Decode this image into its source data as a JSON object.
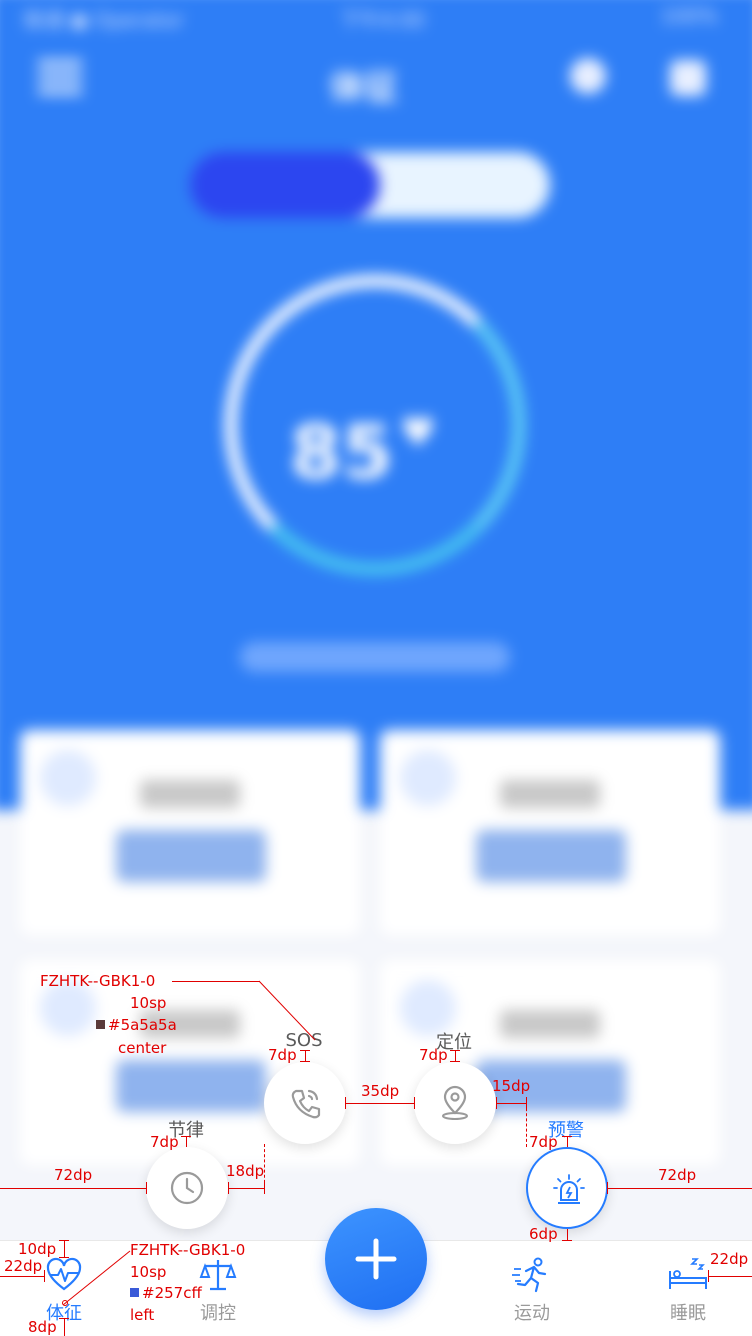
{
  "background": {
    "status_left": "联通 ● Operator",
    "status_center": "下午4:00",
    "status_right": "100%",
    "title": "体征",
    "ring_value": "85"
  },
  "actions": {
    "sos": {
      "label": "SOS",
      "icon": "phone-icon"
    },
    "location": {
      "label": "定位",
      "icon": "location-pin-icon"
    },
    "rhythm": {
      "label": "节律",
      "icon": "clock-icon"
    },
    "warning": {
      "label": "预警",
      "icon": "alarm-siren-icon"
    }
  },
  "tabbar": {
    "tabs": [
      {
        "label": "体征",
        "icon": "heartbeat-icon",
        "active": true
      },
      {
        "label": "调控",
        "icon": "scale-icon",
        "active": false
      },
      {
        "label": "运动",
        "icon": "running-icon",
        "active": false
      },
      {
        "label": "睡眠",
        "icon": "sleep-bed-icon",
        "active": false
      }
    ],
    "center_button_icon": "plus-icon"
  },
  "colors": {
    "accent": "#257cff",
    "label_gray": "#5a5a5a",
    "redline": "#e10000",
    "header_blue": "#2e7ef6"
  },
  "annotations": {
    "spec_top_font": "FZHTK--GBK1-0",
    "spec_top_size": "10sp",
    "spec_top_color": "#5a5a5a",
    "spec_top_align": "center",
    "spec_bottom_font": "FZHTK--GBK1-0",
    "spec_bottom_size": "10sp",
    "spec_bottom_color": "#257cff",
    "spec_bottom_align": "left",
    "d_sos_gap": "7dp",
    "d_loc_gap": "7dp",
    "d_between": "35dp",
    "d_loc_side": "15dp",
    "d_warn_gap": "7dp",
    "d_rhythm_gap": "7dp",
    "d_rhythm_side": "18dp",
    "d_left_edge": "72dp",
    "d_right_edge": "72dp",
    "d_warn_bottom": "6dp",
    "d_tab_top": "10dp",
    "d_tab_left": "22dp",
    "d_tab_bottom": "8dp",
    "d_tab_right": "22dp"
  }
}
